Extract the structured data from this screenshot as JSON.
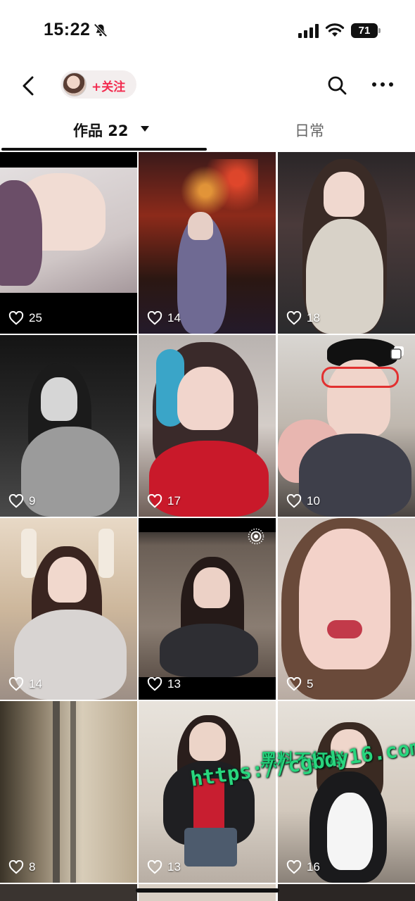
{
  "status_bar": {
    "time": "15:22",
    "battery": "71"
  },
  "header": {
    "follow_label": "+关注"
  },
  "tabs": [
    {
      "label": "作品 22",
      "active": true
    },
    {
      "label": "日常",
      "active": false
    }
  ],
  "posts": [
    {
      "likes": "25"
    },
    {
      "likes": "14"
    },
    {
      "likes": "18"
    },
    {
      "likes": "9"
    },
    {
      "likes": "17"
    },
    {
      "likes": "10"
    },
    {
      "likes": "14"
    },
    {
      "likes": "13"
    },
    {
      "likes": "5"
    },
    {
      "likes": "8"
    },
    {
      "likes": "13"
    },
    {
      "likes": "16"
    }
  ],
  "watermark": {
    "line1": "黑料不打烊",
    "line2": "https://cgbdy16.com"
  },
  "colors": {
    "follow_accent": "#f22a4e",
    "watermark": "#22d07a"
  }
}
